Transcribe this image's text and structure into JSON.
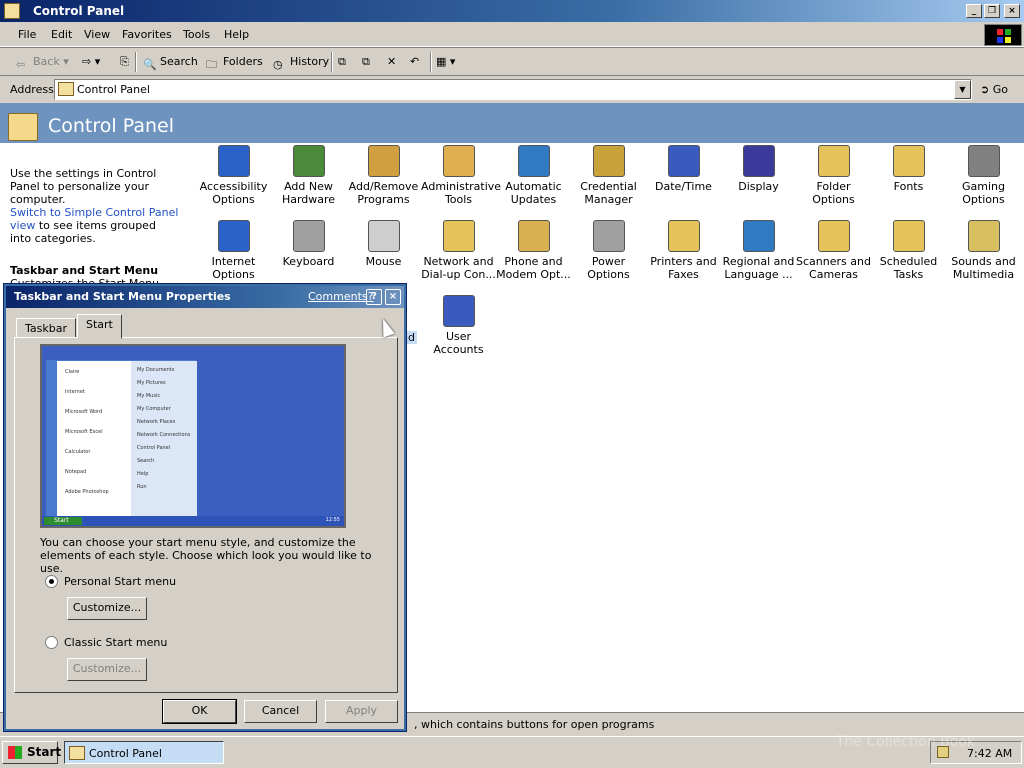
{
  "window": {
    "title": "Control Panel"
  },
  "menu": [
    "File",
    "Edit",
    "View",
    "Favorites",
    "Tools",
    "Help"
  ],
  "toolbar": {
    "back": "Back",
    "search": "Search",
    "folders": "Folders",
    "history": "History"
  },
  "address": {
    "label": "Address",
    "value": "Control Panel",
    "go": "Go"
  },
  "header": {
    "title": "Control Panel"
  },
  "left_pane": {
    "intro": "Use the settings in Control Panel to personalize your computer.",
    "link": "Switch to Simple Control Panel view",
    "link_suffix": "to see items grouped into categories.",
    "heading": "Taskbar and Start Menu",
    "desc": "Customizes the Start Menu, which"
  },
  "items": [
    {
      "label": "Accessibility Options",
      "icon": "accessibility-icon",
      "color": "#2a62c8"
    },
    {
      "label": "Add New Hardware",
      "icon": "hardware-icon",
      "color": "#4a8a3a"
    },
    {
      "label": "Add/Remove Programs",
      "icon": "programs-icon",
      "color": "#d0a040"
    },
    {
      "label": "Administrative Tools",
      "icon": "admin-tools-icon",
      "color": "#e0b050"
    },
    {
      "label": "Automatic Updates",
      "icon": "globe-icon",
      "color": "#2f7ac0"
    },
    {
      "label": "Credential Manager",
      "icon": "keys-icon",
      "color": "#c9a23a"
    },
    {
      "label": "Date/Time",
      "icon": "calendar-clock-icon",
      "color": "#3a5ac0"
    },
    {
      "label": "Display",
      "icon": "display-icon",
      "color": "#3a3a9a"
    },
    {
      "label": "Folder Options",
      "icon": "folder-icon",
      "color": "#e6c25a"
    },
    {
      "label": "Fonts",
      "icon": "fonts-folder-icon",
      "color": "#e6c25a"
    },
    {
      "label": "Gaming Options",
      "icon": "joystick-icon",
      "color": "#808080"
    },
    {
      "label": "Internet Options",
      "icon": "internet-icon",
      "color": "#2a62c8"
    },
    {
      "label": "Keyboard",
      "icon": "keyboard-icon",
      "color": "#a0a0a0"
    },
    {
      "label": "Mouse",
      "icon": "mouse-icon",
      "color": "#cfcfcf"
    },
    {
      "label": "Network and Dial-up Con...",
      "icon": "network-icon",
      "color": "#e6c25a"
    },
    {
      "label": "Phone and Modem Opt...",
      "icon": "phone-icon",
      "color": "#d8b050"
    },
    {
      "label": "Power Options",
      "icon": "power-icon",
      "color": "#a0a0a0"
    },
    {
      "label": "Printers and Faxes",
      "icon": "printer-icon",
      "color": "#e6c25a"
    },
    {
      "label": "Regional and Language ...",
      "icon": "world-icon",
      "color": "#2f7ac0"
    },
    {
      "label": "Scanners and Cameras",
      "icon": "scanner-icon",
      "color": "#e6c25a"
    },
    {
      "label": "Scheduled Tasks",
      "icon": "tasks-icon",
      "color": "#e6c25a"
    },
    {
      "label": "Sounds and Multimedia",
      "icon": "speaker-icon",
      "color": "#d8c060"
    },
    {
      "label": "User Accounts",
      "icon": "user-icon",
      "color": "#3a5ac0"
    }
  ],
  "partial_label": "nd",
  "status": ", which contains buttons for open programs",
  "taskbar": {
    "start": "Start",
    "task": "Control Panel",
    "clock": "7:42 AM"
  },
  "dialog": {
    "title": "Taskbar and Start Menu Properties",
    "comments": "Comments?",
    "help": "?",
    "close": "×",
    "tabs": [
      "Taskbar",
      "Start"
    ],
    "active_tab": "Start",
    "description": "You can choose your start menu style, and customize the elements of each style.  Choose which look you would like to use.",
    "option1": "Personal Start menu",
    "option2": "Classic Start menu",
    "customize": "Customize...",
    "ok": "OK",
    "cancel": "Cancel",
    "apply": "Apply",
    "preview": {
      "start": "Start",
      "clock": "12:55",
      "left_items": [
        "Claire",
        "Internet",
        "Microsoft Word",
        "Microsoft Excel",
        "Calculator",
        "Notepad",
        "Adobe Photoshop"
      ],
      "right_items": [
        "My Documents",
        "My Pictures",
        "My Music",
        "My Computer",
        "Network Places",
        "Network Connections",
        "Control Panel",
        "Search",
        "Help",
        "Run"
      ]
    }
  },
  "watermark": "The Collection Book"
}
